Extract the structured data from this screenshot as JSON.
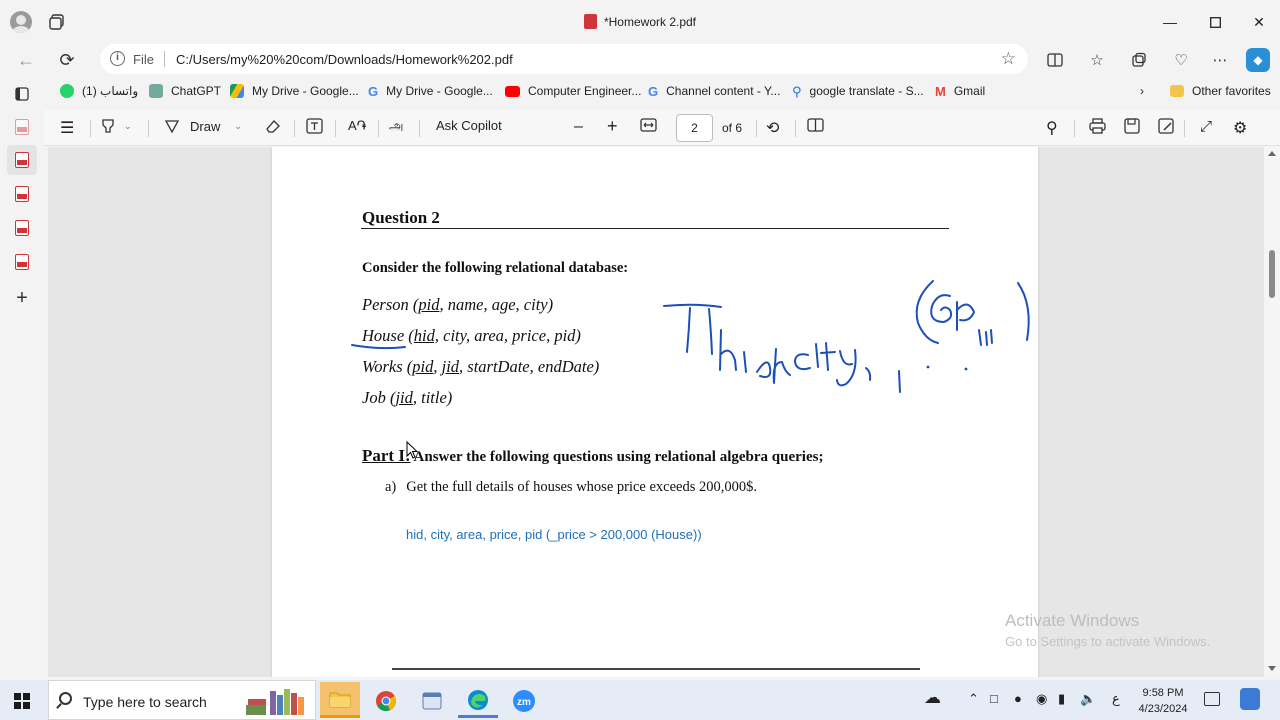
{
  "window": {
    "title": "*Homework 2.pdf"
  },
  "address_bar": {
    "scheme_label": "File",
    "url": "C:/Users/my%20%20com/Downloads/Homework%202.pdf"
  },
  "favorites": [
    {
      "label": "واتساب (1)",
      "icon": "whatsapp-icon",
      "color": "#25d366"
    },
    {
      "label": "ChatGPT",
      "icon": "chatgpt-icon",
      "color": "#74aa9c"
    },
    {
      "label": "My Drive - Google...",
      "icon": "google-drive-icon",
      "color": "#fbbc04"
    },
    {
      "label": "My Drive - Google...",
      "icon": "google-icon",
      "color": "#4285f4"
    },
    {
      "label": "Computer Engineer...",
      "icon": "youtube-icon",
      "color": "#ff0000"
    },
    {
      "label": "Channel content - Y...",
      "icon": "google-icon",
      "color": "#4285f4"
    },
    {
      "label": "google translate - S...",
      "icon": "search-icon",
      "color": "#1a73e8"
    },
    {
      "label": "Gmail",
      "icon": "gmail-icon",
      "color": "#ea4335"
    }
  ],
  "other_favorites_label": "Other favorites",
  "pdf_toolbar": {
    "draw_label": "Draw",
    "copilot_label": "Ask Copilot",
    "current_page": "2",
    "page_total": "of 6"
  },
  "document": {
    "question_title": "Question 2",
    "intro": "Consider the following relational database:",
    "relations": [
      {
        "name": "Person",
        "key": "pid",
        "rest": ", name, age, city)"
      },
      {
        "name": "House",
        "key": "hid,",
        "rest": " city, area, price, pid)"
      },
      {
        "name": "Works",
        "key": "pid",
        "rest2_key": "jid",
        "rest": ", startDate, endDate)"
      },
      {
        "name": "Job",
        "key": "jid",
        "rest": ", title)"
      }
    ],
    "part_label": "Part I:",
    "part_text": " Answer the following questions using relational algebra queries;",
    "question_a_letter": "a)",
    "question_a_text": "Get the full details of houses whose price exceeds 200,000$.",
    "answer_a": "hid, city, area, price, pid (_price > 200,000 (House))"
  },
  "watermark": {
    "line1": "Activate Windows",
    "line2": "Go to Settings to activate Windows."
  },
  "taskbar": {
    "search_placeholder": "Type here to search",
    "language": "ع",
    "time": "9:58 PM",
    "date": "4/23/2024"
  }
}
